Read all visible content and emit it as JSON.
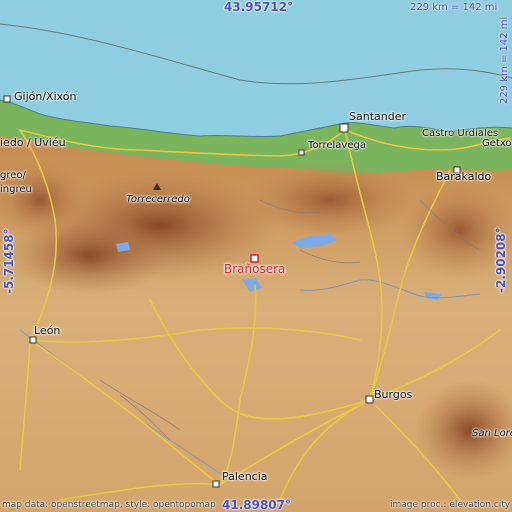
{
  "map": {
    "target_place": "Brañosera",
    "coords": {
      "top_lat": "43.95712°",
      "bottom_lat": "41.89807°",
      "left_lon": "-5.71458°",
      "right_lon": "-2.90208°"
    },
    "scale": {
      "horizontal": "229 km = 142 mi",
      "vertical": "229 km = 142 mi"
    },
    "attribution_left": "map data: openstreetmap, style: opentopomap",
    "attribution_right": "image proc.: elevation.city",
    "places": {
      "gijon": "Gijón/Xixón",
      "oviedo": "iedo / Uviéu",
      "langreo": "Langreo",
      "santander": "Santander",
      "torrelavega": "Torrelavega",
      "castro": "Castro Urdiales",
      "getxo": "Getxo",
      "barakaldo": "Barakaldo",
      "torrecerredo": "Torrecerredo",
      "leon": "León",
      "burgos": "Burgos",
      "palencia": "Palencia",
      "san_lorenzo": "San Lore",
      "mieres": "ingreu",
      "blank_a": "greo/"
    },
    "colors": {
      "sea": "#8fcde0",
      "lowland": "#d9b07a",
      "upland": "#c99257",
      "mountain": "#a96a3a",
      "forest": "#62b25a",
      "road": "#e8c742",
      "water_inland": "#7fa9e6",
      "label_blue": "#4a52c8",
      "target_red": "#d21e2b"
    }
  }
}
